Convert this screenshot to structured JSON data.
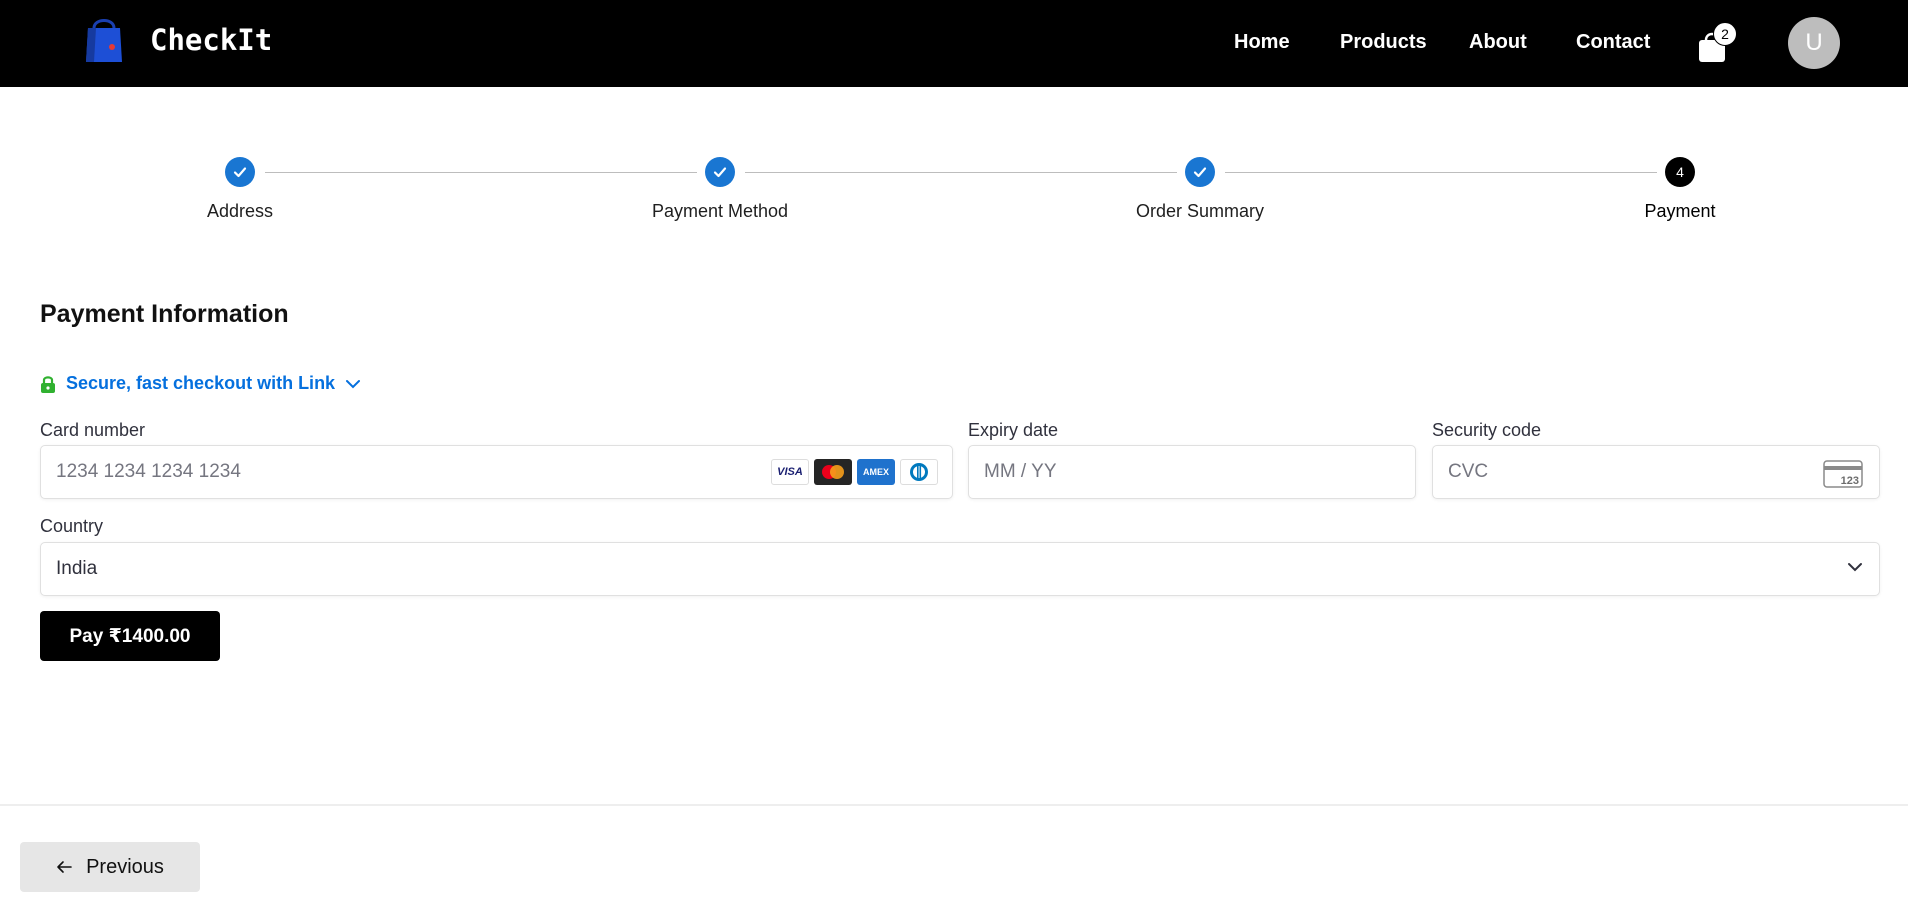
{
  "header": {
    "brand": "CheckIt",
    "nav": [
      "Home",
      "Products",
      "About",
      "Contact"
    ],
    "cart_count": "2",
    "avatar_initial": "U"
  },
  "stepper": {
    "steps": [
      {
        "label": "Address",
        "state": "done"
      },
      {
        "label": "Payment Method",
        "state": "done"
      },
      {
        "label": "Order Summary",
        "state": "done"
      },
      {
        "label": "Payment",
        "state": "active",
        "number": "4"
      }
    ]
  },
  "payment": {
    "title": "Payment Information",
    "link_text": "Secure, fast checkout with Link",
    "card_number": {
      "label": "Card number",
      "placeholder": "1234 1234 1234 1234"
    },
    "card_brands": [
      "VISA",
      "mastercard-icon",
      "AMEX",
      "diners-icon"
    ],
    "expiry": {
      "label": "Expiry date",
      "placeholder": "MM / YY"
    },
    "security": {
      "label": "Security code",
      "placeholder": "CVC",
      "icon_text": "123"
    },
    "country": {
      "label": "Country",
      "value": "India"
    },
    "pay_button": "Pay ₹1400.00"
  },
  "footer": {
    "previous_button": "Previous"
  },
  "colors": {
    "step_done": "#1976d2",
    "link_blue": "#0570de",
    "lock_green": "#30b130"
  }
}
